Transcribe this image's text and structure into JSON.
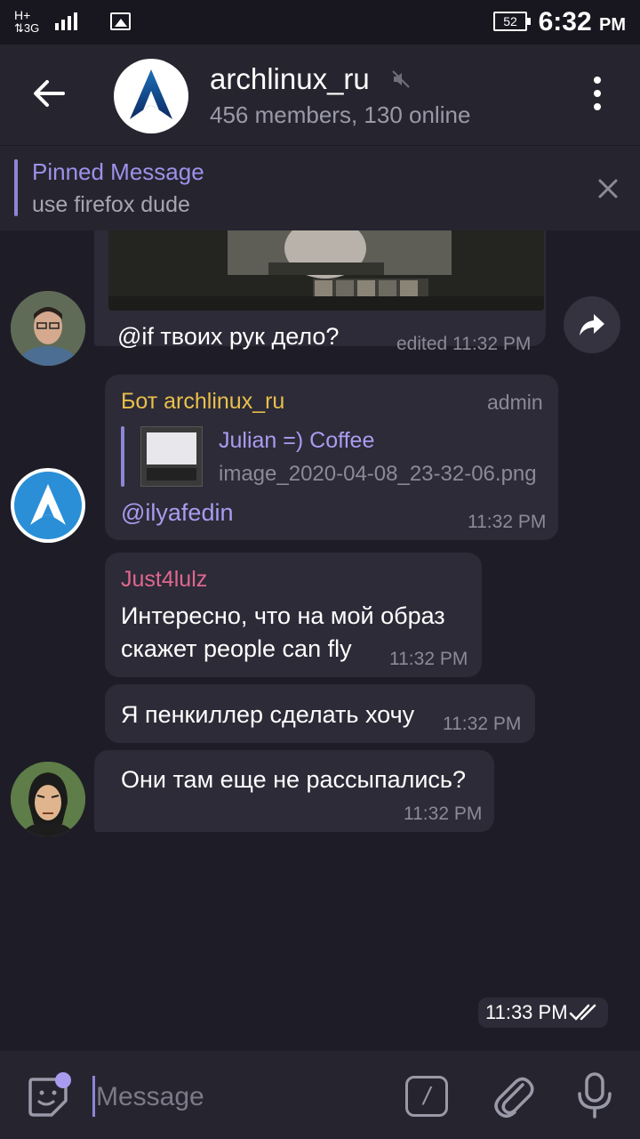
{
  "status_bar": {
    "network": "H+",
    "network2": "3G",
    "battery": "52",
    "time": "6:32",
    "ampm": "PM"
  },
  "header": {
    "title": "archlinux_ru",
    "subtitle": "456 members, 130 online",
    "muted": true
  },
  "pinned": {
    "title": "Pinned Message",
    "text": "use firefox dude"
  },
  "messages": [
    {
      "text": "@if твоих рук дело?",
      "time": "edited 11:32 PM",
      "has_photo": true
    },
    {
      "sender": "Бот archlinux_ru",
      "role": "admin",
      "forward_title": "Julian =) Coffee",
      "forward_file": "image_2020-04-08_23-32-06.png",
      "text": "@ilyafedin",
      "time": "11:32 PM"
    },
    {
      "sender": "Just4lulz",
      "lines": [
        "Интересно, что на мой образ",
        "скажет people can fly"
      ],
      "time": "11:32 PM"
    },
    {
      "text": "Я пенкиллер сделать хочу",
      "time": "11:32 PM"
    },
    {
      "text": "Они там еще не рассыпались?",
      "time": "11:32 PM"
    }
  ],
  "own_message_time": "11:33 PM",
  "composer": {
    "placeholder": "Message",
    "cmd_label": "/"
  },
  "colors": {
    "background": "#1e1d27",
    "header": "#26252f",
    "bubble": "#2c2b37",
    "accent": "#a99cf0",
    "bot_name": "#eabf4c",
    "user_name": "#e0678f"
  }
}
